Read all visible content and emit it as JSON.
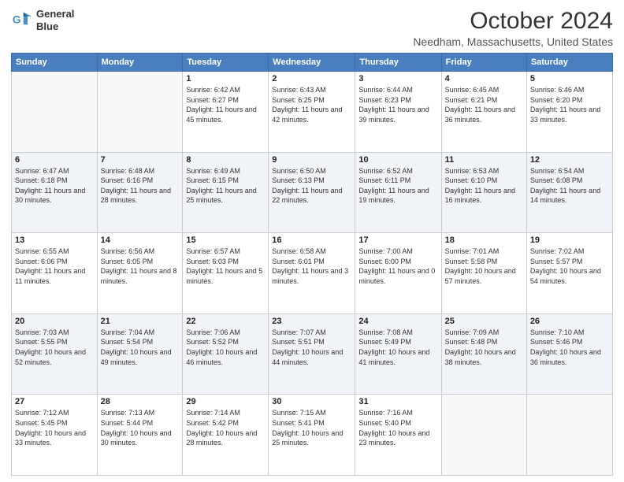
{
  "header": {
    "logo_line1": "General",
    "logo_line2": "Blue",
    "title": "October 2024",
    "subtitle": "Needham, Massachusetts, United States"
  },
  "days_of_week": [
    "Sunday",
    "Monday",
    "Tuesday",
    "Wednesday",
    "Thursday",
    "Friday",
    "Saturday"
  ],
  "weeks": [
    [
      {
        "day": "",
        "detail": ""
      },
      {
        "day": "",
        "detail": ""
      },
      {
        "day": "1",
        "detail": "Sunrise: 6:42 AM\nSunset: 6:27 PM\nDaylight: 11 hours and 45 minutes."
      },
      {
        "day": "2",
        "detail": "Sunrise: 6:43 AM\nSunset: 6:25 PM\nDaylight: 11 hours and 42 minutes."
      },
      {
        "day": "3",
        "detail": "Sunrise: 6:44 AM\nSunset: 6:23 PM\nDaylight: 11 hours and 39 minutes."
      },
      {
        "day": "4",
        "detail": "Sunrise: 6:45 AM\nSunset: 6:21 PM\nDaylight: 11 hours and 36 minutes."
      },
      {
        "day": "5",
        "detail": "Sunrise: 6:46 AM\nSunset: 6:20 PM\nDaylight: 11 hours and 33 minutes."
      }
    ],
    [
      {
        "day": "6",
        "detail": "Sunrise: 6:47 AM\nSunset: 6:18 PM\nDaylight: 11 hours and 30 minutes."
      },
      {
        "day": "7",
        "detail": "Sunrise: 6:48 AM\nSunset: 6:16 PM\nDaylight: 11 hours and 28 minutes."
      },
      {
        "day": "8",
        "detail": "Sunrise: 6:49 AM\nSunset: 6:15 PM\nDaylight: 11 hours and 25 minutes."
      },
      {
        "day": "9",
        "detail": "Sunrise: 6:50 AM\nSunset: 6:13 PM\nDaylight: 11 hours and 22 minutes."
      },
      {
        "day": "10",
        "detail": "Sunrise: 6:52 AM\nSunset: 6:11 PM\nDaylight: 11 hours and 19 minutes."
      },
      {
        "day": "11",
        "detail": "Sunrise: 6:53 AM\nSunset: 6:10 PM\nDaylight: 11 hours and 16 minutes."
      },
      {
        "day": "12",
        "detail": "Sunrise: 6:54 AM\nSunset: 6:08 PM\nDaylight: 11 hours and 14 minutes."
      }
    ],
    [
      {
        "day": "13",
        "detail": "Sunrise: 6:55 AM\nSunset: 6:06 PM\nDaylight: 11 hours and 11 minutes."
      },
      {
        "day": "14",
        "detail": "Sunrise: 6:56 AM\nSunset: 6:05 PM\nDaylight: 11 hours and 8 minutes."
      },
      {
        "day": "15",
        "detail": "Sunrise: 6:57 AM\nSunset: 6:03 PM\nDaylight: 11 hours and 5 minutes."
      },
      {
        "day": "16",
        "detail": "Sunrise: 6:58 AM\nSunset: 6:01 PM\nDaylight: 11 hours and 3 minutes."
      },
      {
        "day": "17",
        "detail": "Sunrise: 7:00 AM\nSunset: 6:00 PM\nDaylight: 11 hours and 0 minutes."
      },
      {
        "day": "18",
        "detail": "Sunrise: 7:01 AM\nSunset: 5:58 PM\nDaylight: 10 hours and 57 minutes."
      },
      {
        "day": "19",
        "detail": "Sunrise: 7:02 AM\nSunset: 5:57 PM\nDaylight: 10 hours and 54 minutes."
      }
    ],
    [
      {
        "day": "20",
        "detail": "Sunrise: 7:03 AM\nSunset: 5:55 PM\nDaylight: 10 hours and 52 minutes."
      },
      {
        "day": "21",
        "detail": "Sunrise: 7:04 AM\nSunset: 5:54 PM\nDaylight: 10 hours and 49 minutes."
      },
      {
        "day": "22",
        "detail": "Sunrise: 7:06 AM\nSunset: 5:52 PM\nDaylight: 10 hours and 46 minutes."
      },
      {
        "day": "23",
        "detail": "Sunrise: 7:07 AM\nSunset: 5:51 PM\nDaylight: 10 hours and 44 minutes."
      },
      {
        "day": "24",
        "detail": "Sunrise: 7:08 AM\nSunset: 5:49 PM\nDaylight: 10 hours and 41 minutes."
      },
      {
        "day": "25",
        "detail": "Sunrise: 7:09 AM\nSunset: 5:48 PM\nDaylight: 10 hours and 38 minutes."
      },
      {
        "day": "26",
        "detail": "Sunrise: 7:10 AM\nSunset: 5:46 PM\nDaylight: 10 hours and 36 minutes."
      }
    ],
    [
      {
        "day": "27",
        "detail": "Sunrise: 7:12 AM\nSunset: 5:45 PM\nDaylight: 10 hours and 33 minutes."
      },
      {
        "day": "28",
        "detail": "Sunrise: 7:13 AM\nSunset: 5:44 PM\nDaylight: 10 hours and 30 minutes."
      },
      {
        "day": "29",
        "detail": "Sunrise: 7:14 AM\nSunset: 5:42 PM\nDaylight: 10 hours and 28 minutes."
      },
      {
        "day": "30",
        "detail": "Sunrise: 7:15 AM\nSunset: 5:41 PM\nDaylight: 10 hours and 25 minutes."
      },
      {
        "day": "31",
        "detail": "Sunrise: 7:16 AM\nSunset: 5:40 PM\nDaylight: 10 hours and 23 minutes."
      },
      {
        "day": "",
        "detail": ""
      },
      {
        "day": "",
        "detail": ""
      }
    ]
  ]
}
